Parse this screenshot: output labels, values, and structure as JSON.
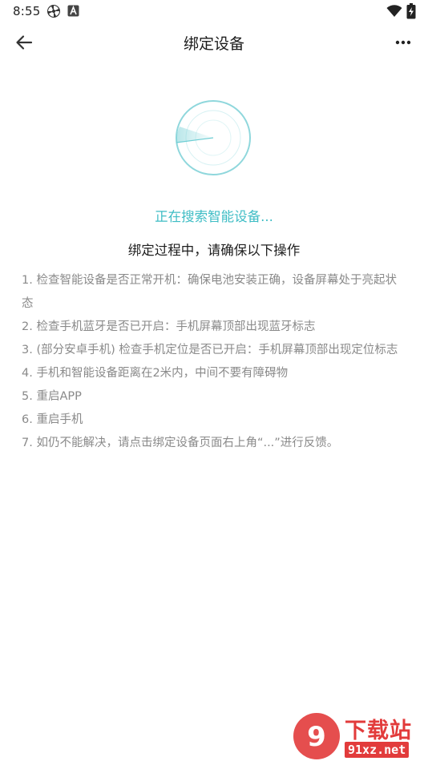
{
  "status_bar": {
    "time": "8:55",
    "icons": [
      "pinwheel-icon",
      "a-badge-icon",
      "wifi-icon",
      "battery-charging-icon"
    ]
  },
  "nav": {
    "title": "绑定设备",
    "back_icon": "arrow-left-icon",
    "more_icon": "more-dots-icon"
  },
  "search": {
    "status": "正在搜索智能设备..."
  },
  "instructions": {
    "title": "绑定过程中，请确保以下操作",
    "items": [
      "1. 检查智能设备是否正常开机：确保电池安装正确，设备屏幕处于亮起状态",
      "2. 检查手机蓝牙是否已开启：手机屏幕顶部出现蓝牙标志",
      "3. (部分安卓手机) 检查手机定位是否已开启：手机屏幕顶部出现定位标志",
      "4. 手机和智能设备距离在2米内，中间不要有障碍物",
      "5. 重启APP",
      "6. 重启手机",
      "7. 如仍不能解决，请点击绑定设备页面右上角“...”进行反馈。"
    ]
  },
  "watermark": {
    "line1": "下载站",
    "line2": "91xz.net"
  },
  "colors": {
    "accent": "#3fbdc5",
    "watermark": "#e23b3b",
    "muted_text": "#8a8a8a"
  }
}
